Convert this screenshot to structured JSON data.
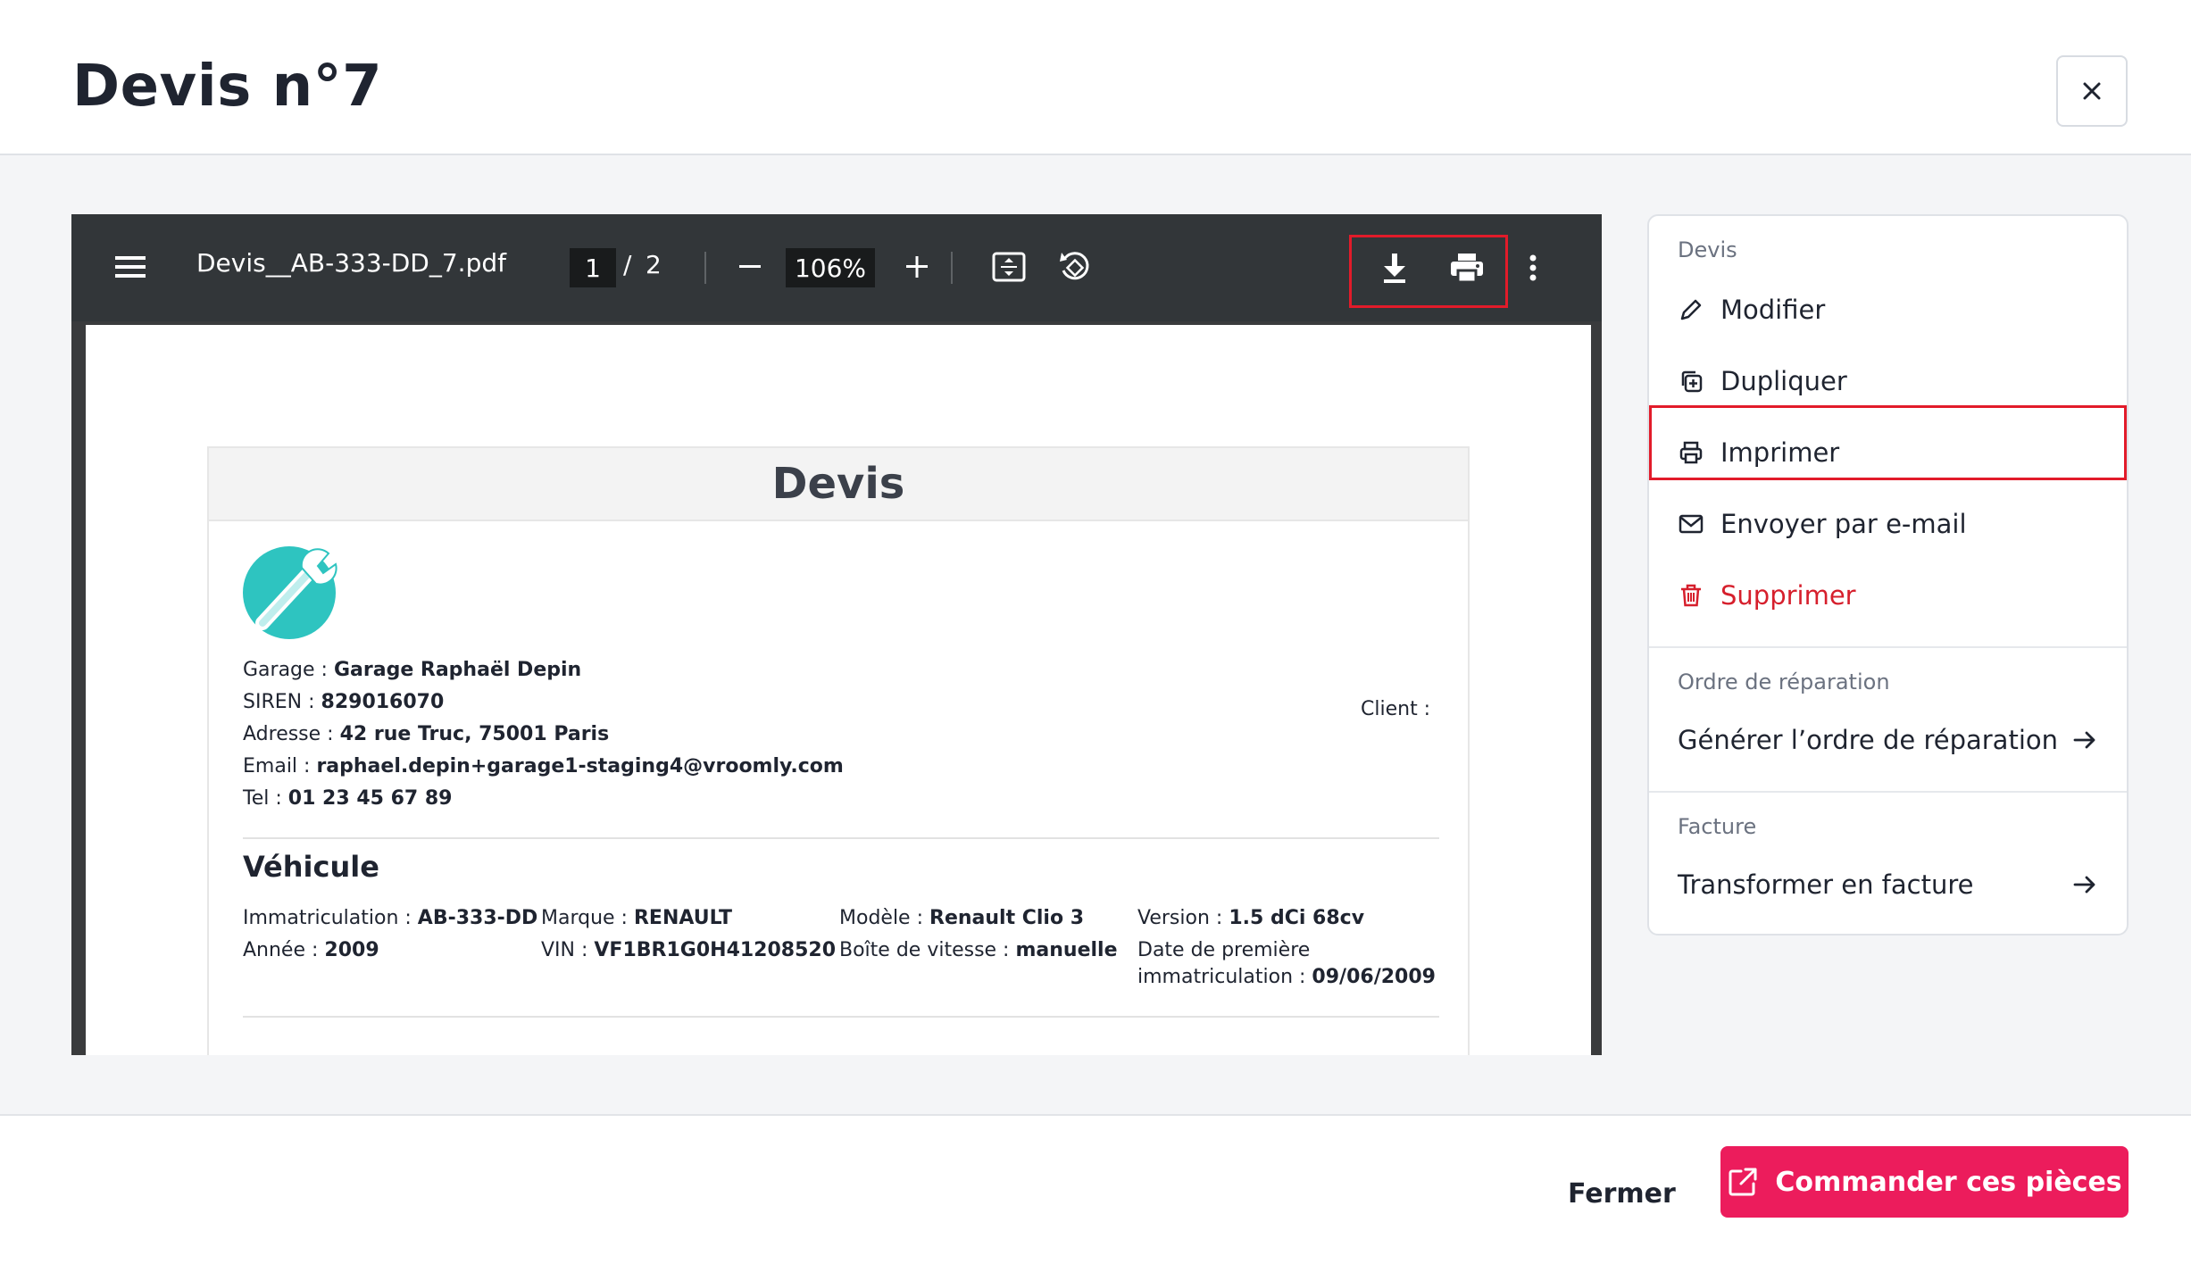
{
  "header": {
    "title": "Devis n°7"
  },
  "viewer": {
    "filename": "Devis__AB-333-DD_7.pdf",
    "page_current": "1",
    "page_sep": "/",
    "page_total": "2",
    "zoom": "106%",
    "icons": [
      "menu-icon",
      "zoom-out-icon",
      "zoom-in-icon",
      "fit-page-icon",
      "rotate-icon",
      "download-icon",
      "print-icon",
      "more-icon"
    ]
  },
  "document": {
    "heading": "Devis",
    "garage_label": "Garage :",
    "garage_value": "Garage Raphaël Depin",
    "siren_label": "SIREN :",
    "siren_value": "829016070",
    "address_label": "Adresse :",
    "address_value": "42 rue Truc, 75001 Paris",
    "email_label": "Email :",
    "email_value": "raphael.depin+garage1-staging4@vroomly.com",
    "tel_label": "Tel :",
    "tel_value": "01 23 45 67 89",
    "client_label": "Client :",
    "vehicle_title": "Véhicule",
    "vehicle": {
      "immat_label": "Immatriculation :",
      "immat_value": "AB-333-DD",
      "marque_label": "Marque :",
      "marque_value": "RENAULT",
      "modele_label": "Modèle :",
      "modele_value": "Renault Clio 3",
      "version_label": "Version :",
      "version_value": "1.5 dCi 68cv",
      "annee_label": "Année :",
      "annee_value": "2009",
      "vin_label": "VIN :",
      "vin_value": "VF1BR1G0H41208520",
      "boite_label": "Boîte de vitesse :",
      "boite_value": "manuelle",
      "date_label_1": "Date de première",
      "date_label_2": "immatriculation :",
      "date_value": "09/06/2009"
    }
  },
  "panel": {
    "devis_title": "Devis",
    "modifier": "Modifier",
    "dupliquer": "Dupliquer",
    "imprimer": "Imprimer",
    "envoyer": "Envoyer par e-mail",
    "supprimer": "Supprimer",
    "ordre_title": "Ordre de réparation",
    "generer": "Générer l’ordre de réparation",
    "facture_title": "Facture",
    "transformer": "Transformer en facture"
  },
  "footer": {
    "fermer": "Fermer",
    "commander": "Commander ces pièces"
  },
  "colors": {
    "accent": "#ec1c5c",
    "danger": "#d61f2c",
    "highlight": "#e21b2a",
    "toolbar": "#323639"
  }
}
